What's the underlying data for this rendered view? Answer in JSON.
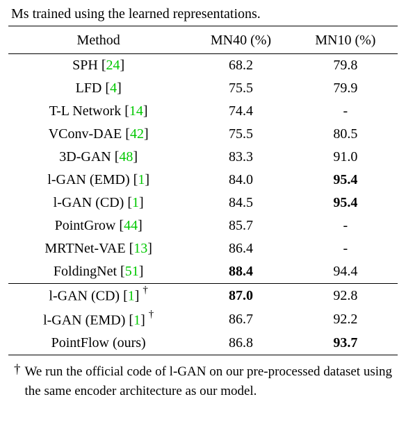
{
  "topline_fragment": "Ms trained using the learned representations.",
  "columns": [
    "Method",
    "MN40 (%)",
    "MN10 (%)"
  ],
  "upper_rows": [
    {
      "name": "SPH",
      "cite": "24",
      "mn40": "68.2",
      "mn40_bold": false,
      "mn10": "79.8",
      "mn10_bold": false,
      "dag": false
    },
    {
      "name": "LFD",
      "cite": "4",
      "mn40": "75.5",
      "mn40_bold": false,
      "mn10": "79.9",
      "mn10_bold": false,
      "dag": false
    },
    {
      "name": "T-L Network",
      "cite": "14",
      "mn40": "74.4",
      "mn40_bold": false,
      "mn10": "-",
      "mn10_bold": false,
      "dag": false
    },
    {
      "name": "VConv-DAE",
      "cite": "42",
      "mn40": "75.5",
      "mn40_bold": false,
      "mn10": "80.5",
      "mn10_bold": false,
      "dag": false
    },
    {
      "name": "3D-GAN",
      "cite": "48",
      "mn40": "83.3",
      "mn40_bold": false,
      "mn10": "91.0",
      "mn10_bold": false,
      "dag": false
    },
    {
      "name": "l-GAN (EMD)",
      "cite": "1",
      "mn40": "84.0",
      "mn40_bold": false,
      "mn10": "95.4",
      "mn10_bold": true,
      "dag": false
    },
    {
      "name": "l-GAN (CD)",
      "cite": "1",
      "mn40": "84.5",
      "mn40_bold": false,
      "mn10": "95.4",
      "mn10_bold": true,
      "dag": false
    },
    {
      "name": "PointGrow",
      "cite": "44",
      "mn40": "85.7",
      "mn40_bold": false,
      "mn10": "-",
      "mn10_bold": false,
      "dag": false
    },
    {
      "name": "MRTNet-VAE",
      "cite": "13",
      "mn40": "86.4",
      "mn40_bold": false,
      "mn10": "-",
      "mn10_bold": false,
      "dag": false
    },
    {
      "name": "FoldingNet",
      "cite": "51",
      "mn40": "88.4",
      "mn40_bold": true,
      "mn10": "94.4",
      "mn10_bold": false,
      "dag": false
    }
  ],
  "lower_rows": [
    {
      "name": "l-GAN (CD)",
      "cite": "1",
      "mn40": "87.0",
      "mn40_bold": true,
      "mn10": "92.8",
      "mn10_bold": false,
      "dag": true
    },
    {
      "name": "l-GAN (EMD)",
      "cite": "1",
      "mn40": "86.7",
      "mn40_bold": false,
      "mn10": "92.2",
      "mn10_bold": false,
      "dag": true
    },
    {
      "name": "PointFlow (ours)",
      "cite": "",
      "mn40": "86.8",
      "mn40_bold": false,
      "mn10": "93.7",
      "mn10_bold": true,
      "dag": false
    }
  ],
  "footnote": {
    "mark": "†",
    "text": "We run the official code of l-GAN on our pre-processed dataset using the same encoder ar­chitecture as our model."
  },
  "chart_data": {
    "type": "table",
    "title": "",
    "columns": [
      "Method",
      "MN40 (%)",
      "MN10 (%)"
    ],
    "sections": [
      {
        "rows": [
          [
            "SPH [24]",
            68.2,
            79.8
          ],
          [
            "LFD [4]",
            75.5,
            79.9
          ],
          [
            "T-L Network [14]",
            74.4,
            null
          ],
          [
            "VConv-DAE [42]",
            75.5,
            80.5
          ],
          [
            "3D-GAN [48]",
            83.3,
            91.0
          ],
          [
            "l-GAN (EMD) [1]",
            84.0,
            95.4
          ],
          [
            "l-GAN (CD) [1]",
            84.5,
            95.4
          ],
          [
            "PointGrow [44]",
            85.7,
            null
          ],
          [
            "MRTNet-VAE [13]",
            86.4,
            null
          ],
          [
            "FoldingNet [51]",
            88.4,
            94.4
          ]
        ]
      },
      {
        "rows": [
          [
            "l-GAN (CD) [1] †",
            87.0,
            92.8
          ],
          [
            "l-GAN (EMD) [1] †",
            86.7,
            92.2
          ],
          [
            "PointFlow (ours)",
            86.8,
            93.7
          ]
        ]
      }
    ],
    "bold_cells": {
      "MN40": [
        "FoldingNet [51]",
        "l-GAN (CD) [1] †"
      ],
      "MN10": [
        "l-GAN (EMD) [1]",
        "l-GAN (CD) [1]",
        "PointFlow (ours)"
      ]
    }
  }
}
